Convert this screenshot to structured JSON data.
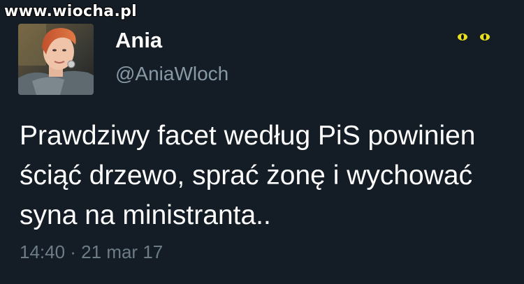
{
  "watermark": "www.wiocha.pl",
  "tweet": {
    "author_name": "Ania",
    "author_handle": "@AniaWloch",
    "text_lines": [
      "Prawdziwy facet według PiS powinien",
      "ściąć drzewo, sprać żonę i wychować",
      "syna na ministranta.."
    ],
    "timestamp": "14:40 · 21 mar 17"
  },
  "icons": {
    "avatar": "profile-photo",
    "overflow": "eyes-icon"
  },
  "colors": {
    "background": "#141d26",
    "text": "#ffffff",
    "secondary_text": "#8899a6",
    "timestamp": "#6e7c88",
    "eyes": "#e6e020"
  }
}
